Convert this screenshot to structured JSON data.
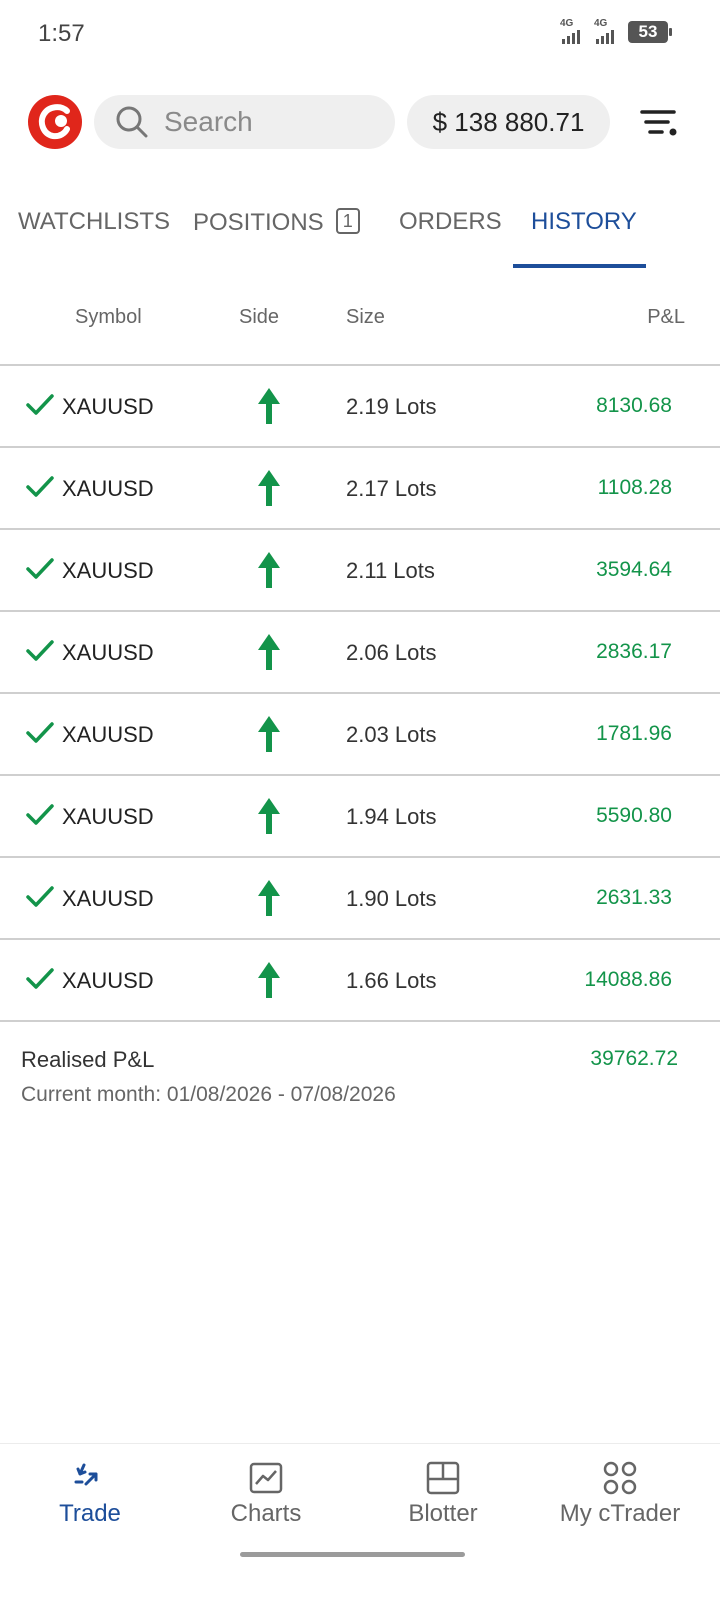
{
  "status_bar": {
    "time": "1:57",
    "signal1_label": "4G",
    "signal2_label": "4G",
    "battery": "53"
  },
  "header": {
    "logo_icon": "ctrader-logo-icon",
    "search_placeholder": "Search",
    "balance": "$ 138 880.71",
    "filter_icon": "filter-icon"
  },
  "tabs": [
    {
      "label": "WATCHLISTS"
    },
    {
      "label": "POSITIONS",
      "badge": "1"
    },
    {
      "label": "ORDERS"
    },
    {
      "label": "HISTORY",
      "active": true
    }
  ],
  "table": {
    "headers": [
      "Symbol",
      "Side",
      "Size",
      "P&L"
    ],
    "rows": [
      {
        "symbol": "XAUUSD",
        "side": "buy",
        "size": "2.19 Lots",
        "pnl": "8130.68"
      },
      {
        "symbol": "XAUUSD",
        "side": "buy",
        "size": "2.17 Lots",
        "pnl": "1108.28"
      },
      {
        "symbol": "XAUUSD",
        "side": "buy",
        "size": "2.11 Lots",
        "pnl": "3594.64"
      },
      {
        "symbol": "XAUUSD",
        "side": "buy",
        "size": "2.06 Lots",
        "pnl": "2836.17"
      },
      {
        "symbol": "XAUUSD",
        "side": "buy",
        "size": "2.03 Lots",
        "pnl": "1781.96"
      },
      {
        "symbol": "XAUUSD",
        "side": "buy",
        "size": "1.94 Lots",
        "pnl": "5590.80"
      },
      {
        "symbol": "XAUUSD",
        "side": "buy",
        "size": "1.90 Lots",
        "pnl": "2631.33"
      },
      {
        "symbol": "XAUUSD",
        "side": "buy",
        "size": "1.66 Lots",
        "pnl": "14088.86"
      }
    ]
  },
  "summary": {
    "label": "Realised P&L",
    "value": "39762.72",
    "range": "Current month: 01/08/2026 - 07/08/2026"
  },
  "bottom_nav": [
    {
      "label": "Trade",
      "icon": "trade-icon",
      "active": true
    },
    {
      "label": "Charts",
      "icon": "charts-icon"
    },
    {
      "label": "Blotter",
      "icon": "blotter-icon"
    },
    {
      "label": "My cTrader",
      "icon": "my-ctrader-icon"
    }
  ],
  "colors": {
    "accent": "#1d4e9a",
    "profit": "#13944a",
    "buy_arrow": "#13944a",
    "logo": "#e0261b"
  }
}
